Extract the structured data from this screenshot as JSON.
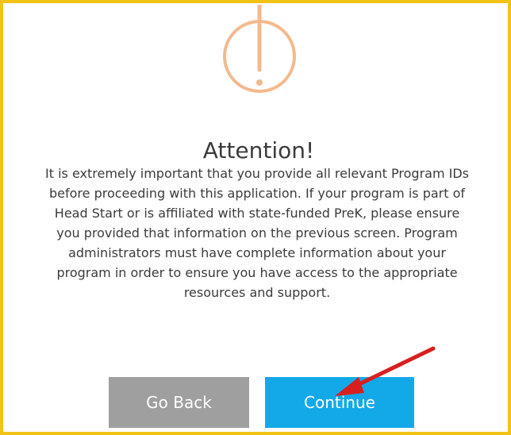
{
  "dialog": {
    "title": "Attention!",
    "message_lines": [
      "It is extremely important that you provide all relevant Program IDs",
      "before proceeding with this application. If your program is part of",
      "Head Start or is affiliated with state-funded PreK, please ensure",
      "you provided that information on the previous screen. Program",
      "administrators must have complete information about your",
      "program in order to ensure you have access to the appropriate",
      "resources and support."
    ],
    "icon": "exclamation-circle-icon",
    "buttons": {
      "back_label": "Go Back",
      "continue_label": "Continue"
    }
  },
  "colors": {
    "frame_border": "#f2c316",
    "icon_accent": "#f4b98c",
    "back_button": "#9f9f9f",
    "continue_button": "#13a9e9",
    "annotation_arrow": "#d81f1f",
    "text": "#3b3b3b"
  }
}
